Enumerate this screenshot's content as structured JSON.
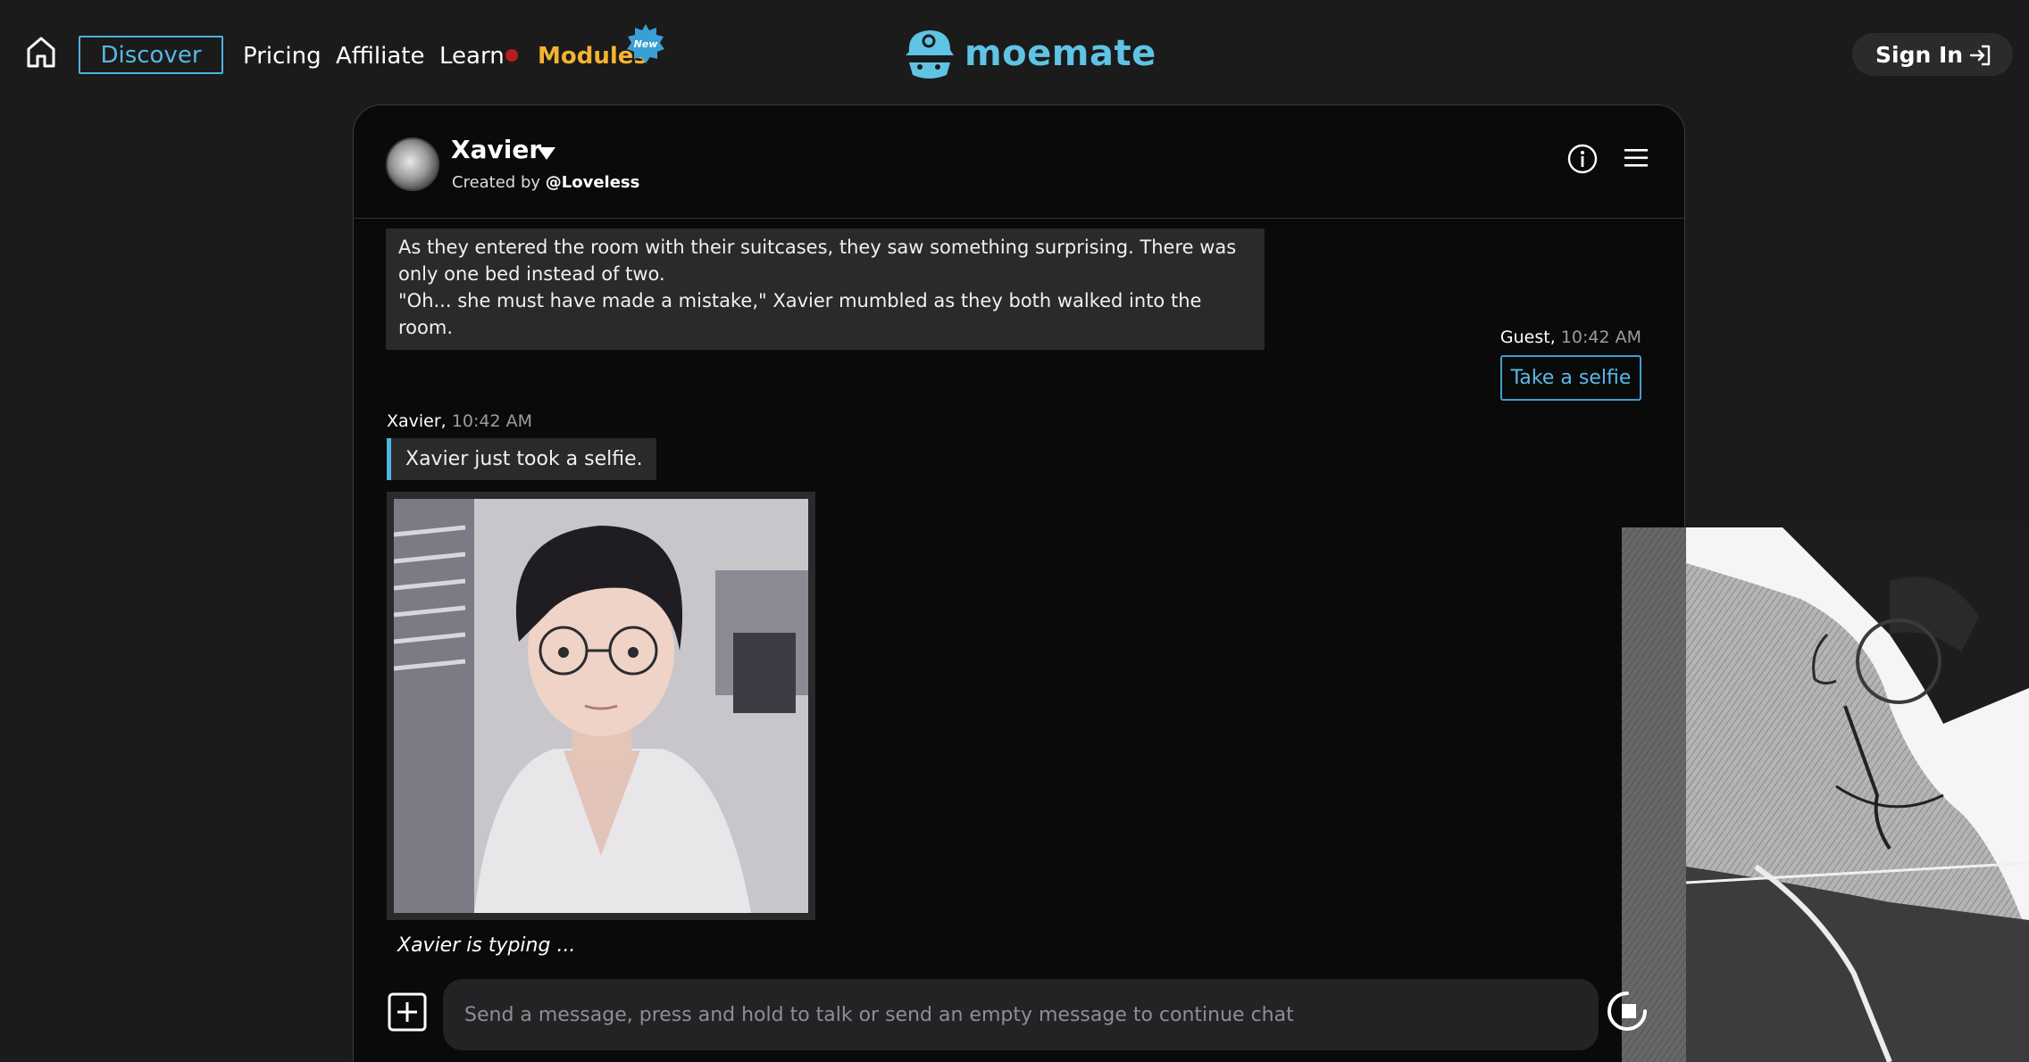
{
  "nav": {
    "home_icon": "home-icon",
    "discover": "Discover",
    "pricing": "Pricing",
    "affiliate": "Affiliate",
    "learn": "Learn",
    "modules": "Modules",
    "new_badge": "New",
    "logo_text": "moemate",
    "sign_in": "Sign In"
  },
  "colors": {
    "accent": "#4db3df",
    "modules": "#f4b331",
    "notification_dot": "#b81d1d",
    "background": "#1b1b1b",
    "panel": "#0a0a0b"
  },
  "chat": {
    "character_name": "Xavier",
    "created_by_prefix": "Created by ",
    "creator": "@Loveless",
    "messages": {
      "narration_line1": "As they entered the room with their suitcases, they saw something surprising. There was only one bed instead of two.",
      "narration_line2": "\"Oh... she must have made a mistake,\" Xavier mumbled as they both walked into the room.",
      "guest_name": "Guest,",
      "guest_time": "10:42 AM",
      "guest_message": "Take a selfie",
      "xavier_name": "Xavier,",
      "xavier_time": "10:42 AM",
      "action_text": "Xavier just took a selfie."
    },
    "typing_indicator": "Xavier is typing ...",
    "input_placeholder": "Send a message, press and hold to talk or send an empty message to continue chat"
  }
}
